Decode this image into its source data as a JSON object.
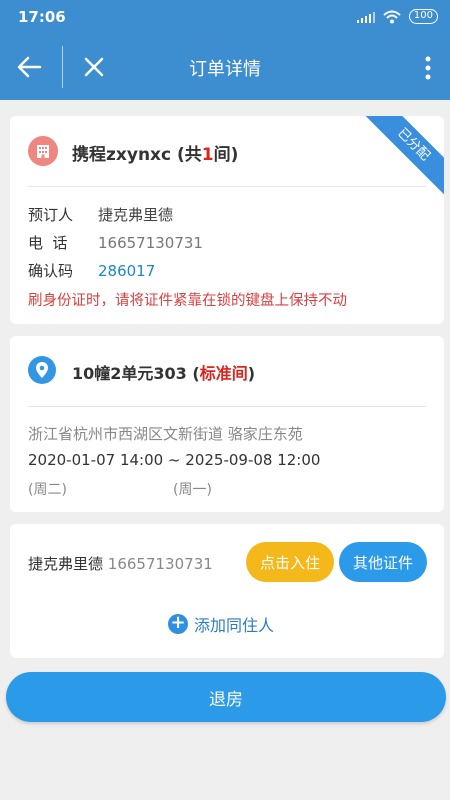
{
  "status_bar": {
    "time": "17:06",
    "battery": "100"
  },
  "app_bar": {
    "title": "订单详情"
  },
  "order": {
    "status_ribbon": "已分配",
    "hotel_name_prefix": "携程zxynxc (共",
    "room_count": "1",
    "hotel_name_suffix": "间)",
    "booker_label": "预订人",
    "booker_value": "捷克弗里德",
    "phone_label": "电  话",
    "phone_value": "16657130731",
    "confirm_label": "确认码",
    "confirm_value": "286017",
    "warning": "刷身份证时，请将证件紧靠在锁的键盘上保持不动"
  },
  "room": {
    "name_prefix": "10幢2单元303 (",
    "room_type": "标准间",
    "name_suffix": ")",
    "address": "浙江省杭州市西湖区文新街道 骆家庄东苑",
    "date_range": "2020-01-07 14:00 ~ 2025-09-08 12:00",
    "start_weekday": "(周二)",
    "end_weekday": "(周一)"
  },
  "guest": {
    "name": "捷克弗里德",
    "phone": "16657130731",
    "checkin_button": "点击入住",
    "other_id_button": "其他证件",
    "add_companion": "添加同住人"
  },
  "checkout_button": "退房",
  "colors": {
    "primary": "#3c8ed0",
    "button_blue": "#2b9ae8",
    "button_yellow": "#f5b81a",
    "warning_red": "#d94040",
    "hotel_icon": "#ef8680"
  },
  "icons": [
    "signal-icon",
    "wifi-icon",
    "battery-icon",
    "back-arrow-icon",
    "close-icon",
    "more-vert-icon",
    "building-icon",
    "location-pin-icon",
    "plus-circle-icon"
  ]
}
